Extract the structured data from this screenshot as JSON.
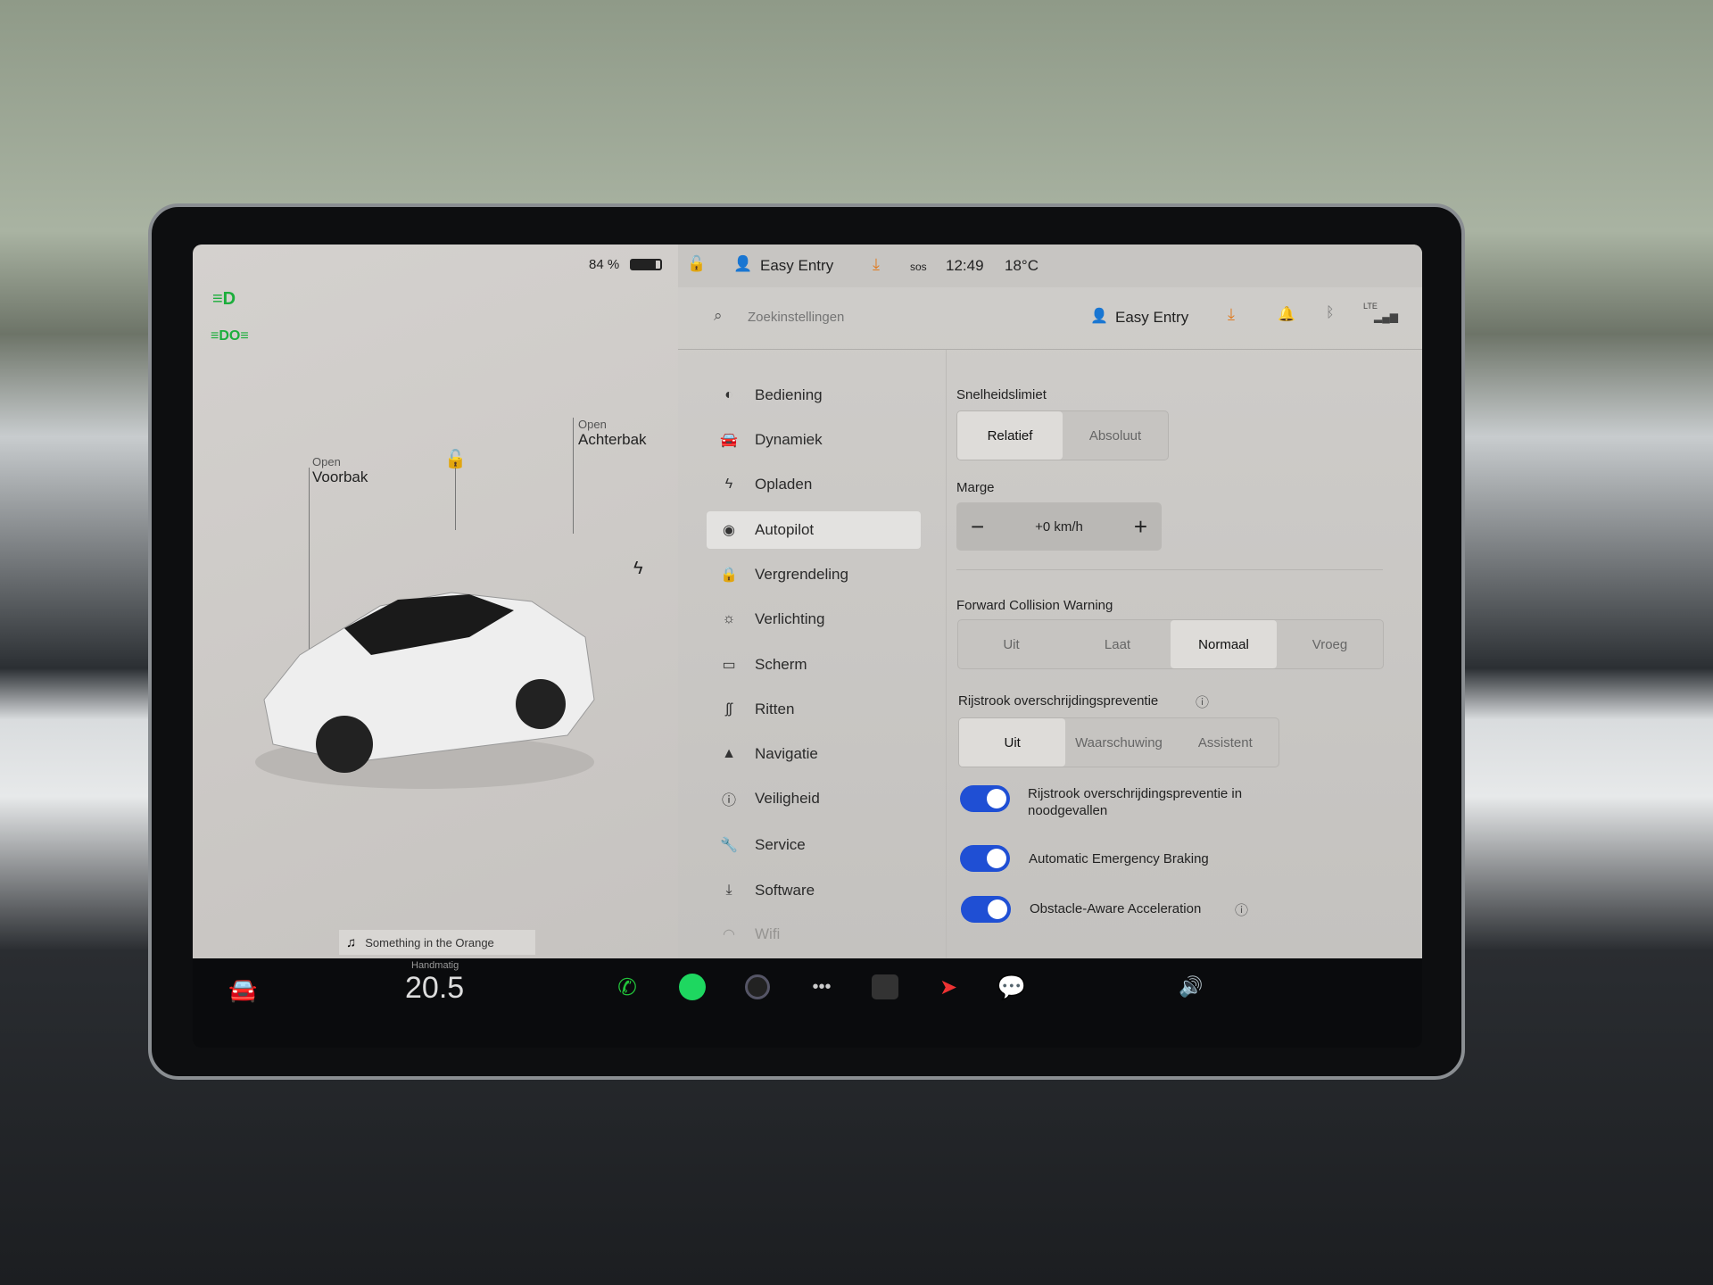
{
  "left_panel": {
    "battery": "84 %",
    "frunk": {
      "state": "Open",
      "label": "Voorbak"
    },
    "trunk": {
      "state": "Open",
      "label": "Achterbak"
    },
    "media": {
      "track": "Something in the Orange"
    }
  },
  "status_bar": {
    "profile": "Easy Entry",
    "sos": "sos",
    "time": "12:49",
    "temperature": "18°C"
  },
  "settings_header": {
    "search_placeholder": "Zoekinstellingen",
    "profile": "Easy Entry",
    "network": "LTE"
  },
  "menu": [
    {
      "label": "Bediening",
      "icon": "toggle-icon"
    },
    {
      "label": "Dynamiek",
      "icon": "car-icon"
    },
    {
      "label": "Opladen",
      "icon": "bolt-icon"
    },
    {
      "label": "Autopilot",
      "icon": "steering-wheel-icon",
      "active": true
    },
    {
      "label": "Vergrendeling",
      "icon": "lock-icon"
    },
    {
      "label": "Verlichting",
      "icon": "sun-icon"
    },
    {
      "label": "Scherm",
      "icon": "display-icon"
    },
    {
      "label": "Ritten",
      "icon": "trips-icon"
    },
    {
      "label": "Navigatie",
      "icon": "navigation-icon"
    },
    {
      "label": "Veiligheid",
      "icon": "safety-icon"
    },
    {
      "label": "Service",
      "icon": "wrench-icon"
    },
    {
      "label": "Software",
      "icon": "download-icon"
    },
    {
      "label": "Wifi",
      "icon": "wifi-icon"
    }
  ],
  "autopilot": {
    "speed_limit": {
      "label": "Snelheidslimiet",
      "options": [
        "Relatief",
        "Absoluut"
      ],
      "selected": "Relatief"
    },
    "margin": {
      "label": "Marge",
      "value": "+0 km/h",
      "minus": "−",
      "plus": "+"
    },
    "fcw": {
      "label": "Forward Collision Warning",
      "options": [
        "Uit",
        "Laat",
        "Normaal",
        "Vroeg"
      ],
      "selected": "Normaal"
    },
    "lane": {
      "label": "Rijstrook overschrijdingspreventie",
      "options": [
        "Uit",
        "Waarschuwing",
        "Assistent"
      ],
      "selected": "Uit"
    },
    "toggles": [
      {
        "label": "Rijstrook overschrijdingspreventie in noodgevallen",
        "on": true
      },
      {
        "label": "Automatic Emergency Braking",
        "on": true
      },
      {
        "label": "Obstacle-Aware Acceleration",
        "on": true
      }
    ]
  },
  "dock": {
    "climate_mode": "Handmatig",
    "temperature": "20.5",
    "accent": "#1f4fd4"
  }
}
